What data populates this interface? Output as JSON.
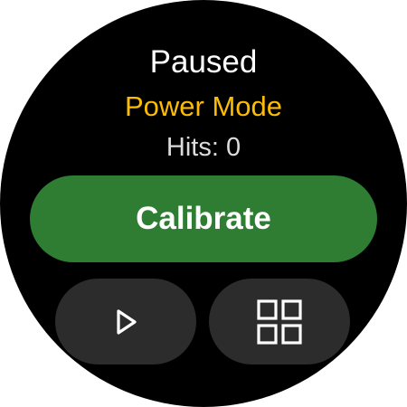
{
  "status": {
    "state": "Paused",
    "mode": "Power Mode",
    "hits": "Hits: 0"
  },
  "actions": {
    "calibrate_label": "Calibrate",
    "play_icon": "play-icon",
    "grid_icon": "grid-icon"
  },
  "colors": {
    "background": "#000000",
    "primary_text": "#ffffff",
    "mode_accent": "#fbbc05",
    "secondary_text": "#dcdcdc",
    "calibrate_bg": "#2e7d32",
    "secondary_button_bg": "#2c2c2c",
    "icon_color": "#ffffff"
  }
}
